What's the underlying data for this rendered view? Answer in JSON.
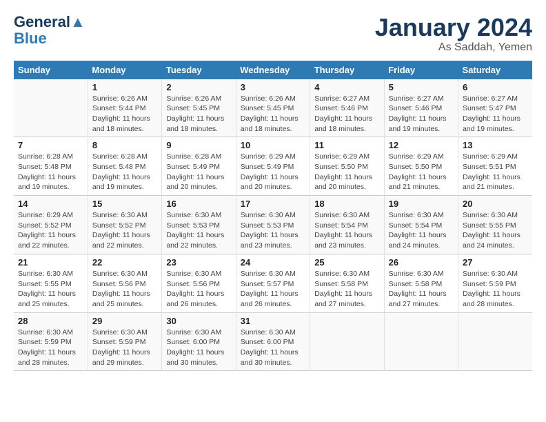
{
  "header": {
    "logo_line1": "General",
    "logo_line2": "Blue",
    "month": "January 2024",
    "location": "As Saddah, Yemen"
  },
  "days_of_week": [
    "Sunday",
    "Monday",
    "Tuesday",
    "Wednesday",
    "Thursday",
    "Friday",
    "Saturday"
  ],
  "weeks": [
    [
      {
        "day": "",
        "info": ""
      },
      {
        "day": "1",
        "info": "Sunrise: 6:26 AM\nSunset: 5:44 PM\nDaylight: 11 hours and 18 minutes."
      },
      {
        "day": "2",
        "info": "Sunrise: 6:26 AM\nSunset: 5:45 PM\nDaylight: 11 hours and 18 minutes."
      },
      {
        "day": "3",
        "info": "Sunrise: 6:26 AM\nSunset: 5:45 PM\nDaylight: 11 hours and 18 minutes."
      },
      {
        "day": "4",
        "info": "Sunrise: 6:27 AM\nSunset: 5:46 PM\nDaylight: 11 hours and 18 minutes."
      },
      {
        "day": "5",
        "info": "Sunrise: 6:27 AM\nSunset: 5:46 PM\nDaylight: 11 hours and 19 minutes."
      },
      {
        "day": "6",
        "info": "Sunrise: 6:27 AM\nSunset: 5:47 PM\nDaylight: 11 hours and 19 minutes."
      }
    ],
    [
      {
        "day": "7",
        "info": "Sunrise: 6:28 AM\nSunset: 5:48 PM\nDaylight: 11 hours and 19 minutes."
      },
      {
        "day": "8",
        "info": "Sunrise: 6:28 AM\nSunset: 5:48 PM\nDaylight: 11 hours and 19 minutes."
      },
      {
        "day": "9",
        "info": "Sunrise: 6:28 AM\nSunset: 5:49 PM\nDaylight: 11 hours and 20 minutes."
      },
      {
        "day": "10",
        "info": "Sunrise: 6:29 AM\nSunset: 5:49 PM\nDaylight: 11 hours and 20 minutes."
      },
      {
        "day": "11",
        "info": "Sunrise: 6:29 AM\nSunset: 5:50 PM\nDaylight: 11 hours and 20 minutes."
      },
      {
        "day": "12",
        "info": "Sunrise: 6:29 AM\nSunset: 5:50 PM\nDaylight: 11 hours and 21 minutes."
      },
      {
        "day": "13",
        "info": "Sunrise: 6:29 AM\nSunset: 5:51 PM\nDaylight: 11 hours and 21 minutes."
      }
    ],
    [
      {
        "day": "14",
        "info": "Sunrise: 6:29 AM\nSunset: 5:52 PM\nDaylight: 11 hours and 22 minutes."
      },
      {
        "day": "15",
        "info": "Sunrise: 6:30 AM\nSunset: 5:52 PM\nDaylight: 11 hours and 22 minutes."
      },
      {
        "day": "16",
        "info": "Sunrise: 6:30 AM\nSunset: 5:53 PM\nDaylight: 11 hours and 22 minutes."
      },
      {
        "day": "17",
        "info": "Sunrise: 6:30 AM\nSunset: 5:53 PM\nDaylight: 11 hours and 23 minutes."
      },
      {
        "day": "18",
        "info": "Sunrise: 6:30 AM\nSunset: 5:54 PM\nDaylight: 11 hours and 23 minutes."
      },
      {
        "day": "19",
        "info": "Sunrise: 6:30 AM\nSunset: 5:54 PM\nDaylight: 11 hours and 24 minutes."
      },
      {
        "day": "20",
        "info": "Sunrise: 6:30 AM\nSunset: 5:55 PM\nDaylight: 11 hours and 24 minutes."
      }
    ],
    [
      {
        "day": "21",
        "info": "Sunrise: 6:30 AM\nSunset: 5:55 PM\nDaylight: 11 hours and 25 minutes."
      },
      {
        "day": "22",
        "info": "Sunrise: 6:30 AM\nSunset: 5:56 PM\nDaylight: 11 hours and 25 minutes."
      },
      {
        "day": "23",
        "info": "Sunrise: 6:30 AM\nSunset: 5:56 PM\nDaylight: 11 hours and 26 minutes."
      },
      {
        "day": "24",
        "info": "Sunrise: 6:30 AM\nSunset: 5:57 PM\nDaylight: 11 hours and 26 minutes."
      },
      {
        "day": "25",
        "info": "Sunrise: 6:30 AM\nSunset: 5:58 PM\nDaylight: 11 hours and 27 minutes."
      },
      {
        "day": "26",
        "info": "Sunrise: 6:30 AM\nSunset: 5:58 PM\nDaylight: 11 hours and 27 minutes."
      },
      {
        "day": "27",
        "info": "Sunrise: 6:30 AM\nSunset: 5:59 PM\nDaylight: 11 hours and 28 minutes."
      }
    ],
    [
      {
        "day": "28",
        "info": "Sunrise: 6:30 AM\nSunset: 5:59 PM\nDaylight: 11 hours and 28 minutes."
      },
      {
        "day": "29",
        "info": "Sunrise: 6:30 AM\nSunset: 5:59 PM\nDaylight: 11 hours and 29 minutes."
      },
      {
        "day": "30",
        "info": "Sunrise: 6:30 AM\nSunset: 6:00 PM\nDaylight: 11 hours and 30 minutes."
      },
      {
        "day": "31",
        "info": "Sunrise: 6:30 AM\nSunset: 6:00 PM\nDaylight: 11 hours and 30 minutes."
      },
      {
        "day": "",
        "info": ""
      },
      {
        "day": "",
        "info": ""
      },
      {
        "day": "",
        "info": ""
      }
    ]
  ]
}
